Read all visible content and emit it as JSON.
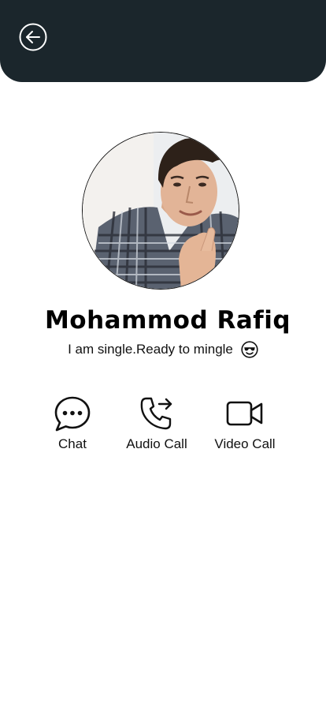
{
  "header": {
    "background": "#1b262c",
    "back_icon": "arrow-left-circle-icon"
  },
  "profile": {
    "name": "Mohammod Rafiq",
    "status": "I am single.Ready to mingle",
    "status_emoji": "smiling-face-with-sunglasses-icon"
  },
  "actions": [
    {
      "label": "Chat",
      "icon": "chat-bubble-icon"
    },
    {
      "label": "Audio Call",
      "icon": "phone-outgoing-icon"
    },
    {
      "label": "Video Call",
      "icon": "video-camera-icon"
    }
  ]
}
